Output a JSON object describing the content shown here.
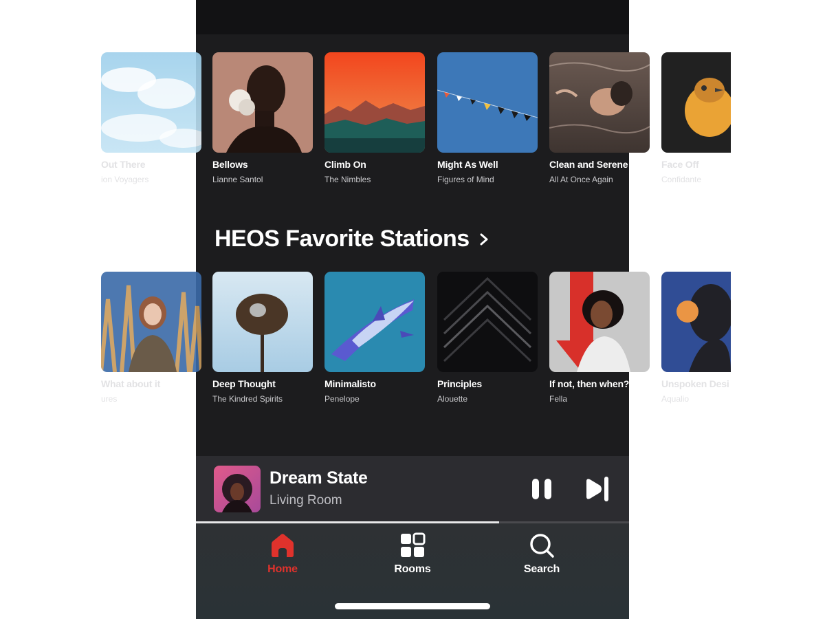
{
  "colors": {
    "background": "#1c1c1e",
    "accent": "#e0322c",
    "text": "#ffffff",
    "subtext": "#c9c9cc"
  },
  "row1": [
    {
      "title": "Out There",
      "subtitle": "ion Voyagers",
      "art": "sky-clouds"
    },
    {
      "title": "Bellows",
      "subtitle": "Lianne Santol",
      "art": "portrait-woman-pink"
    },
    {
      "title": "Climb On",
      "subtitle": "The Nimbles",
      "art": "sunset-mountains"
    },
    {
      "title": "Might As Well",
      "subtitle": "Figures of Mind",
      "art": "blue-bunting"
    },
    {
      "title": "Clean and Serene",
      "subtitle": "All At Once Again",
      "art": "woman-in-water"
    },
    {
      "title": "Face Off",
      "subtitle": "Confidante",
      "art": "bird-orange"
    }
  ],
  "section": {
    "title": "HEOS Favorite Stations"
  },
  "row2": [
    {
      "title": "What about it",
      "subtitle": "ures",
      "art": "woman-in-grass"
    },
    {
      "title": "Deep Thought",
      "subtitle": "The Kindred Spirits",
      "art": "palm-tree"
    },
    {
      "title": "Minimalisto",
      "subtitle": "Penelope",
      "art": "shark"
    },
    {
      "title": "Principles",
      "subtitle": "Alouette",
      "art": "chevrons-dark"
    },
    {
      "title": "If not, then when?",
      "subtitle": "Fella",
      "art": "woman-red-arrow"
    },
    {
      "title": "Unspoken Desi",
      "subtitle": "Aqualio",
      "art": "silhouette-orange"
    }
  ],
  "now_playing": {
    "title": "Dream State",
    "room": "Living Room",
    "progress": 0.7
  },
  "tabs": [
    {
      "label": "Home",
      "icon": "home-icon",
      "active": true
    },
    {
      "label": "Rooms",
      "icon": "rooms-icon",
      "active": false
    },
    {
      "label": "Search",
      "icon": "search-icon",
      "active": false
    }
  ]
}
